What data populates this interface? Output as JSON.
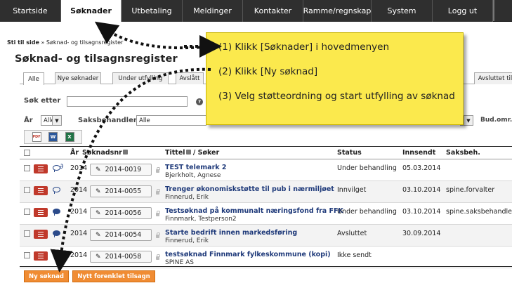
{
  "nav": {
    "items": [
      "Startside",
      "Søknader",
      "Utbetaling",
      "Meldinger",
      "Kontakter",
      "Ramme/regnskap",
      "System",
      "Logg ut"
    ]
  },
  "breadcrumb": {
    "root": "Sti til side",
    "separator": "»",
    "current": "Søknad- og tilsagnsregister"
  },
  "page_title": "Søknad- og tilsagnsregister",
  "tabs": [
    "Alle",
    "Nye søknader",
    "Under utfylling",
    "Avslått",
    "Avsluttet til"
  ],
  "filters": {
    "search_label": "Søk etter",
    "search_value": "",
    "year_label": "År",
    "year_value": "Alle",
    "caseworker_label": "Saksbehandler",
    "caseworker_value": "Alle",
    "budget_label": "Bud.omr."
  },
  "export": {
    "pdf": "PDF",
    "word": "W",
    "excel": "X"
  },
  "table": {
    "columns": {
      "year": "År",
      "number": "Søknadsnr",
      "title": "Tittel",
      "applicant": "/ Søker",
      "status": "Status",
      "submitted": "Innsendt",
      "caseworker": "Saksbeh."
    },
    "rows": [
      {
        "year": "2014",
        "number": "2014-0019",
        "title": "TEST telemark 2",
        "applicant": "Bjerkholt, Agnese",
        "status": "Under behandling",
        "submitted": "05.03.2014",
        "caseworker": ""
      },
      {
        "year": "2014",
        "number": "2014-0055",
        "title": "Trenger økonomiskstøtte til pub i nærmiljøet",
        "applicant": "Finnerud, Erik",
        "status": "Innvilget",
        "submitted": "03.10.2014",
        "caseworker": "spine.forvalter"
      },
      {
        "year": "2014",
        "number": "2014-0056",
        "title": "Testsøknad på kommunalt næringsfond fra FFK",
        "applicant": "Finnmark, Testperson2",
        "status": "Under behandling",
        "submitted": "03.10.2014",
        "caseworker": "spine.saksbehandle"
      },
      {
        "year": "2014",
        "number": "2014-0054",
        "title": "Starte bedrift innen markedsføring",
        "applicant": "Finnerud, Erik",
        "status": "Avsluttet",
        "submitted": "30.09.2014",
        "caseworker": ""
      },
      {
        "year": "2014",
        "number": "2014-0058",
        "title": "testsøknad Finnmark fylkeskommune (kopi)",
        "applicant": "SPINE AS",
        "status": "Ikke sendt",
        "submitted": "",
        "caseworker": ""
      }
    ]
  },
  "buttons": {
    "new_application": "Ny søknad",
    "new_simplified_grant": "Nytt forenklet tilsagn"
  },
  "callout": {
    "step1": "(1) Klikk [Søknader] i hovedmenyen",
    "step2": "(2) Klikk [Ny søknad]",
    "step3": "(3) Velg støtteordning og start utfylling av søknad"
  },
  "colors": {
    "nav_bg": "#2f2f2f",
    "callout_bg": "#fbe94d",
    "action_button": "#f08c33",
    "menu_button": "#c0392b",
    "title_link": "#1f3a7a"
  }
}
